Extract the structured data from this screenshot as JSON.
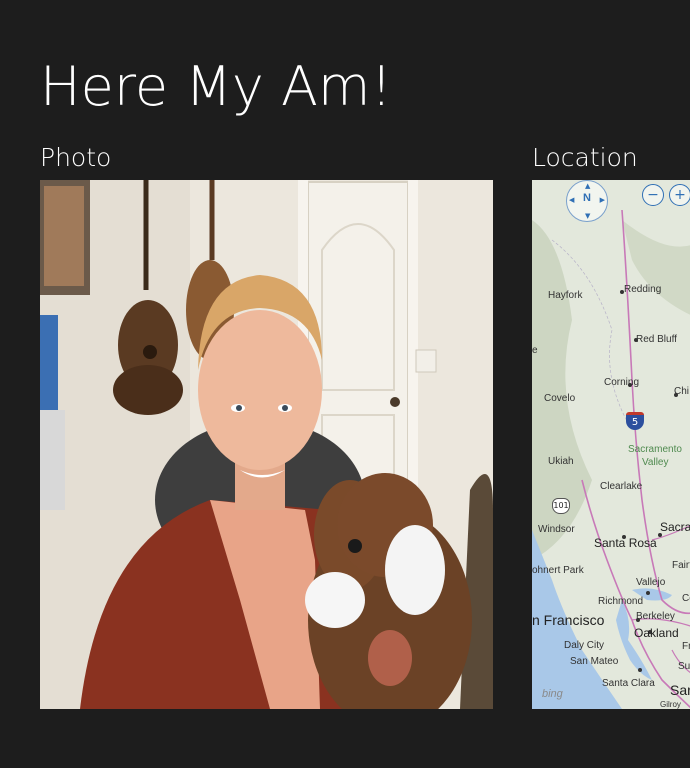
{
  "app": {
    "title": "Here My Am!"
  },
  "sections": {
    "photo": {
      "header": "Photo"
    },
    "location": {
      "header": "Location"
    }
  },
  "map": {
    "compass_label": "N",
    "zoom_out": "−",
    "zoom_in": "+",
    "interstate_number": "5",
    "highway_number": "101",
    "provider": "bing",
    "places": {
      "redding": "Redding",
      "hayfork": "Hayfork",
      "red_bluff": "Red Bluff",
      "corning": "Corning",
      "chico": "Chi",
      "covelo": "Covelo",
      "sacramento_valley_1": "Sacramento",
      "sacramento_valley_2": "Valley",
      "ukiah": "Ukiah",
      "clearlake": "Clearlake",
      "windsor": "Windsor",
      "sacramento": "Sacrament",
      "santa_rosa": "Santa Rosa",
      "fairfield": "Fairfie",
      "rohnert_park": "ohnert Park",
      "vallejo": "Vallejo",
      "richmond": "Richmond",
      "concord": "Concor",
      "san_francisco": "n Francisco",
      "berkeley": "Berkeley",
      "oakland": "Oakland",
      "daly_city": "Daly City",
      "fremont": "Fremo",
      "san_mateo": "San Mateo",
      "sunnyvale": "Sunnyv",
      "santa_clara": "Santa Clara",
      "san_jose": "Sar",
      "gilroy": "Gilroy",
      "edge_e": "e"
    }
  }
}
